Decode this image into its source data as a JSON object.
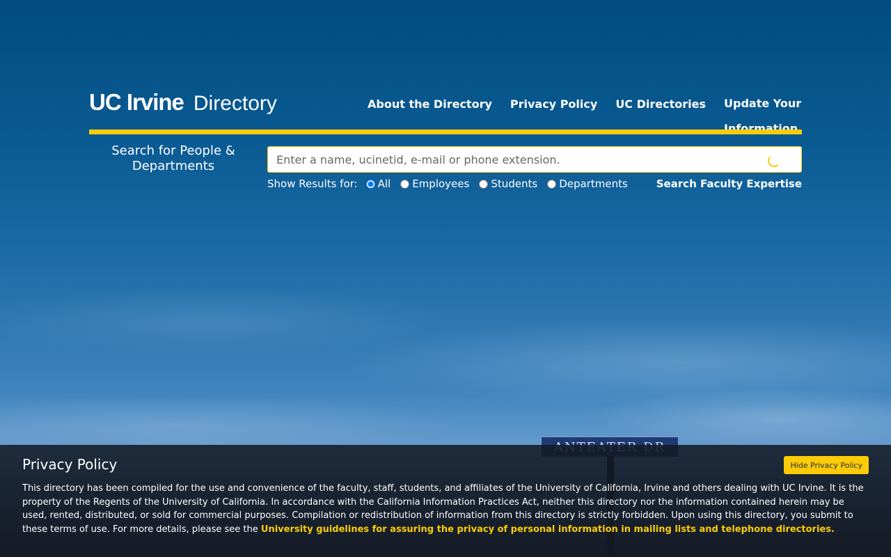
{
  "header": {
    "logo_uc_irvine": "UC Irvine",
    "logo_directory": "Directory",
    "nav": [
      {
        "label": "About the Directory"
      },
      {
        "label": "Privacy Policy"
      },
      {
        "label": "UC Directories"
      },
      {
        "label": "Update Your Information"
      }
    ]
  },
  "search": {
    "label": "Search for People & Departments",
    "placeholder": "Enter a name, ucinetid, e-mail or phone extension.",
    "value": "",
    "filters_label": "Show Results for:",
    "filters": [
      {
        "label": "All",
        "checked": true
      },
      {
        "label": "Employees",
        "checked": false
      },
      {
        "label": "Students",
        "checked": false
      },
      {
        "label": "Departments",
        "checked": false
      }
    ],
    "faculty_link": "Search Faculty Expertise"
  },
  "background": {
    "street_sign": "ANTEATER DR"
  },
  "privacy_panel": {
    "title": "Privacy Policy",
    "hide_button": "Hide Privacy Policy",
    "text": "This directory has been compiled for the use and convenience of the faculty, staff, students, and affiliates of the University of California, Irvine and others dealing with UC Irvine. It is the property of the Regents of the University of California. In accordance with the California Information Practices Act, neither this directory nor the information contained herein may be used, rented, distributed, or sold for commercial purposes. Compilation or redistribution of information from this directory is strictly forbidden. Upon using this directory, you submit to these terms of use. For more details, please see the ",
    "link": "University guidelines for assuring the privacy of personal information in mailing lists and telephone directories."
  },
  "colors": {
    "accent_gold": "#fecc07",
    "sky_blue": "#004c80"
  },
  "icons": [
    "loading-spinner-icon"
  ]
}
